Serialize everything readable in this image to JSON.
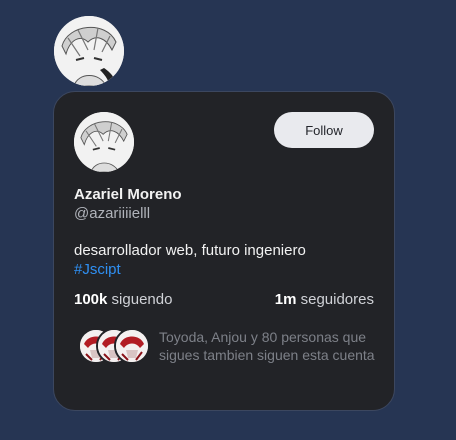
{
  "profile": {
    "name": "Azariel Moreno",
    "handle": "@azariiiielll",
    "bio": "desarrollador web, futuro ingeniero",
    "hashtag": "#Jscipt"
  },
  "actions": {
    "follow_label": "Follow"
  },
  "stats": {
    "following_count": "100k",
    "following_label": "siguendo",
    "followers_count": "1m",
    "followers_label": "seguidores"
  },
  "mutuals": {
    "text": "Toyoda, Anjou y 80 personas que sigues tambien siguen esta cuenta"
  },
  "colors": {
    "page_background": "#263553",
    "card_background": "#222327",
    "accent_link": "#2f8ff2",
    "button_background": "#e9eaee"
  }
}
